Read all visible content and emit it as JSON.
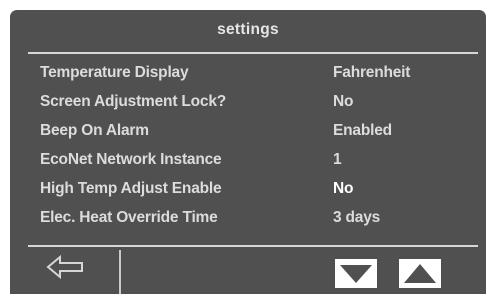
{
  "header": {
    "title": "settings"
  },
  "settings": [
    {
      "label": "Temperature Display",
      "value": "Fahrenheit"
    },
    {
      "label": "Screen Adjustment Lock?",
      "value": "No"
    },
    {
      "label": "Beep On Alarm",
      "value": "Enabled"
    },
    {
      "label": "EcoNet Network Instance",
      "value": "1"
    },
    {
      "label": "High Temp Adjust Enable",
      "value": "No"
    },
    {
      "label": "Elec. Heat Override Time",
      "value": "3 days"
    }
  ],
  "footer": {
    "back_icon": "arrow-left-outline-icon",
    "down_icon": "triangle-down-icon",
    "up_icon": "triangle-up-icon"
  },
  "colors": {
    "screen_bg": "#505050",
    "text": "#dcdcdc",
    "rule": "#d7d7d7",
    "button": "#ffffff"
  }
}
